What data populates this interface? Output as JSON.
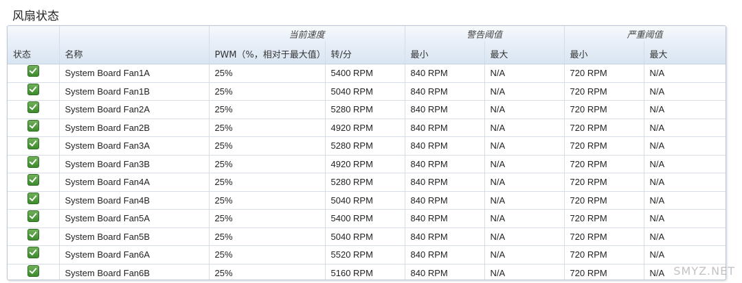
{
  "page_title": "风扇状态",
  "header_groups": {
    "current_speed": "当前速度",
    "warning_threshold": "警告阈值",
    "critical_threshold": "严重阈值"
  },
  "columns": {
    "status": "状态",
    "name": "名称",
    "pwm": "PWM（%，相对于最大值）",
    "rpm": "转/分",
    "warn_min": "最小",
    "warn_max": "最大",
    "crit_min": "最小",
    "crit_max": "最大"
  },
  "rows": [
    {
      "status": "ok",
      "name": "System Board Fan1A",
      "pwm": "25%",
      "rpm": "5400 RPM",
      "warn_min": "840 RPM",
      "warn_max": "N/A",
      "crit_min": "720 RPM",
      "crit_max": "N/A"
    },
    {
      "status": "ok",
      "name": "System Board Fan1B",
      "pwm": "25%",
      "rpm": "5040 RPM",
      "warn_min": "840 RPM",
      "warn_max": "N/A",
      "crit_min": "720 RPM",
      "crit_max": "N/A"
    },
    {
      "status": "ok",
      "name": "System Board Fan2A",
      "pwm": "25%",
      "rpm": "5280 RPM",
      "warn_min": "840 RPM",
      "warn_max": "N/A",
      "crit_min": "720 RPM",
      "crit_max": "N/A"
    },
    {
      "status": "ok",
      "name": "System Board Fan2B",
      "pwm": "25%",
      "rpm": "4920 RPM",
      "warn_min": "840 RPM",
      "warn_max": "N/A",
      "crit_min": "720 RPM",
      "crit_max": "N/A"
    },
    {
      "status": "ok",
      "name": "System Board Fan3A",
      "pwm": "25%",
      "rpm": "5280 RPM",
      "warn_min": "840 RPM",
      "warn_max": "N/A",
      "crit_min": "720 RPM",
      "crit_max": "N/A"
    },
    {
      "status": "ok",
      "name": "System Board Fan3B",
      "pwm": "25%",
      "rpm": "4920 RPM",
      "warn_min": "840 RPM",
      "warn_max": "N/A",
      "crit_min": "720 RPM",
      "crit_max": "N/A"
    },
    {
      "status": "ok",
      "name": "System Board Fan4A",
      "pwm": "25%",
      "rpm": "5280 RPM",
      "warn_min": "840 RPM",
      "warn_max": "N/A",
      "crit_min": "720 RPM",
      "crit_max": "N/A"
    },
    {
      "status": "ok",
      "name": "System Board Fan4B",
      "pwm": "25%",
      "rpm": "5040 RPM",
      "warn_min": "840 RPM",
      "warn_max": "N/A",
      "crit_min": "720 RPM",
      "crit_max": "N/A"
    },
    {
      "status": "ok",
      "name": "System Board Fan5A",
      "pwm": "25%",
      "rpm": "5400 RPM",
      "warn_min": "840 RPM",
      "warn_max": "N/A",
      "crit_min": "720 RPM",
      "crit_max": "N/A"
    },
    {
      "status": "ok",
      "name": "System Board Fan5B",
      "pwm": "25%",
      "rpm": "5040 RPM",
      "warn_min": "840 RPM",
      "warn_max": "N/A",
      "crit_min": "720 RPM",
      "crit_max": "N/A"
    },
    {
      "status": "ok",
      "name": "System Board Fan6A",
      "pwm": "25%",
      "rpm": "5520 RPM",
      "warn_min": "840 RPM",
      "warn_max": "N/A",
      "crit_min": "720 RPM",
      "crit_max": "N/A"
    },
    {
      "status": "ok",
      "name": "System Board Fan6B",
      "pwm": "25%",
      "rpm": "5160 RPM",
      "warn_min": "840 RPM",
      "warn_max": "N/A",
      "crit_min": "720 RPM",
      "crit_max": "N/A"
    }
  ],
  "icons": {
    "status_ok": "checkmark-icon"
  },
  "colors": {
    "status_ok": "#3d8a2c",
    "header_bg": "#dfe8f3"
  },
  "watermark": "SMYZ.NET"
}
